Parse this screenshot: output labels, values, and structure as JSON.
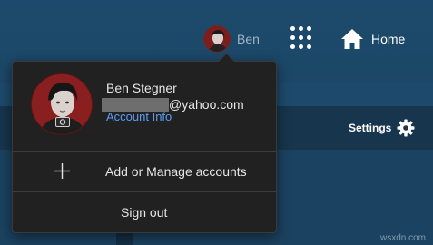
{
  "header": {
    "user_name": "Ben",
    "home_label": "Home"
  },
  "toolbar": {
    "settings_label": "Settings"
  },
  "account_menu": {
    "name": "Ben Stegner",
    "email_domain": "@yahoo.com",
    "account_info_label": "Account Info",
    "add_manage_label": "Add or Manage accounts",
    "sign_out_label": "Sign out"
  },
  "footer": {
    "watermark": "wsxdn.com"
  },
  "colors": {
    "page_bg": "#1d4a6c",
    "menu_bg": "#212121",
    "link": "#5b9cf6",
    "avatar_red": "#8a1f1f"
  }
}
